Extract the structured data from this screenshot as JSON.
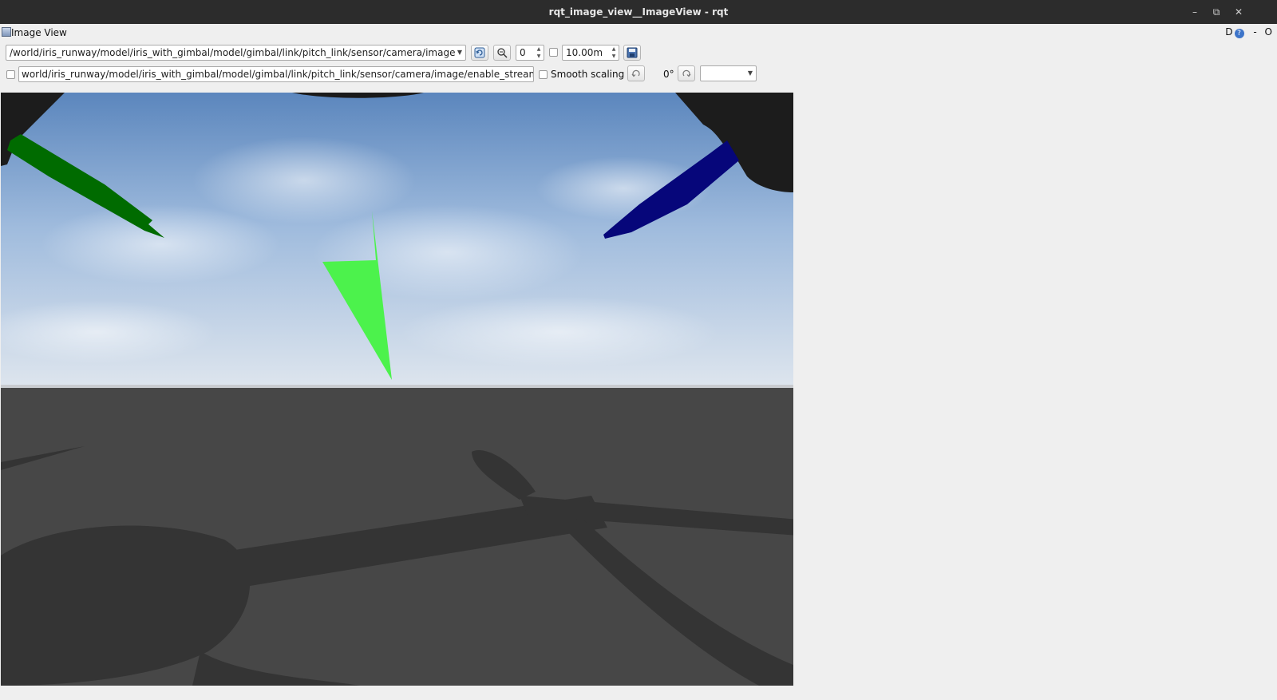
{
  "window": {
    "title": "rqt_image_view__ImageView - rqt",
    "controls": {
      "minimize": "–",
      "restore": "⧉",
      "close": "✕"
    }
  },
  "dock": {
    "title": "Image View",
    "right_d": "D",
    "right_help": "?",
    "right_dash": "-",
    "right_o": "O"
  },
  "toolbar": {
    "topic": "/world/iris_runway/model/iris_with_gimbal/model/gimbal/link/pitch_link/sensor/camera/image",
    "zoom_value": "0",
    "depth_value": "10.00m",
    "publish_topic": "world/iris_runway/model/iris_with_gimbal/model/gimbal/link/pitch_link/sensor/camera/image/enable_streaming",
    "smooth_scaling_label": "Smooth scaling",
    "rotation_label": "0°",
    "color_scheme": ""
  },
  "colors": {
    "sky_top": "#5b86bd",
    "sky_bottom": "#dfe6ee",
    "ground": "#474747",
    "propeller_green": "#006b00",
    "propeller_blue": "#06067a",
    "arrow_green": "#4cf24c"
  },
  "icons": {
    "refresh": "refresh-icon",
    "zoom": "zoom-icon",
    "save": "save-icon",
    "rotate_left": "rotate-left-icon",
    "rotate_right": "rotate-right-icon"
  }
}
